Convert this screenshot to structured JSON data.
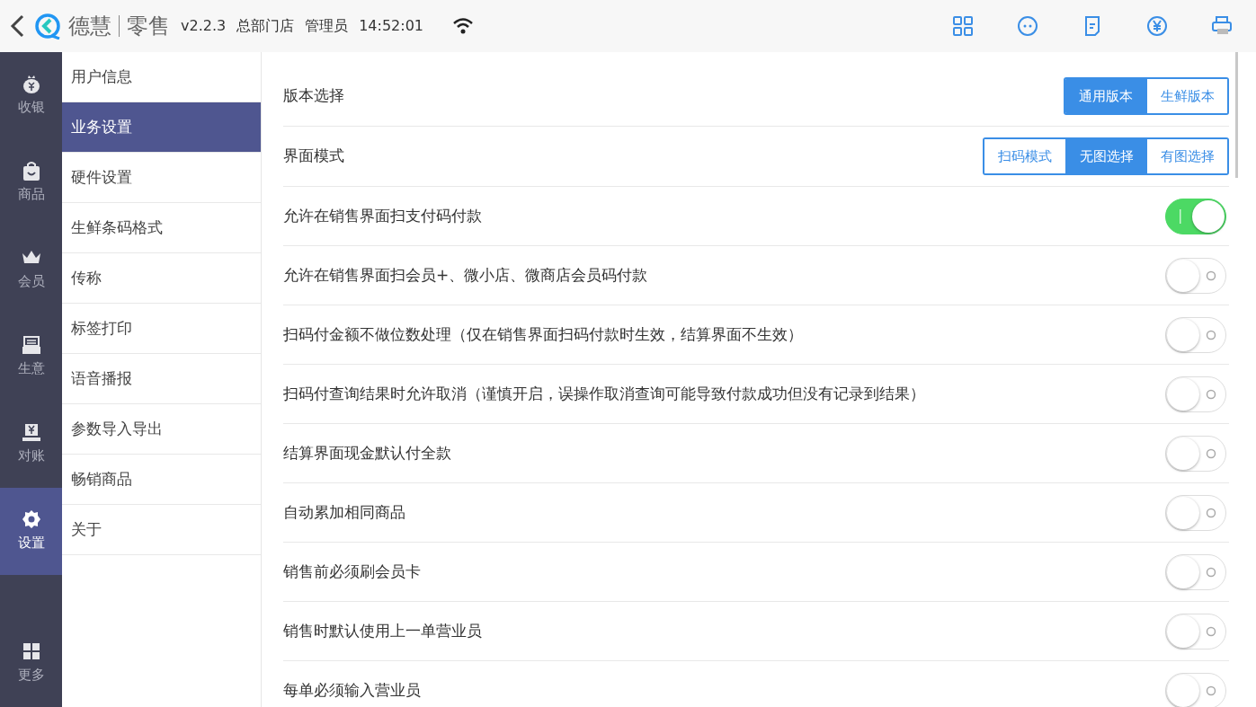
{
  "header": {
    "brand": "德慧",
    "product": "零售",
    "version": "v2.2.3",
    "store": "总部门店",
    "role": "管理员",
    "time": "14:52:01"
  },
  "rail": [
    {
      "label": "收银",
      "selected": false
    },
    {
      "label": "商品",
      "selected": false
    },
    {
      "label": "会员",
      "selected": false
    },
    {
      "label": "生意",
      "selected": false
    },
    {
      "label": "对账",
      "selected": false
    },
    {
      "label": "设置",
      "selected": true
    },
    {
      "label": "更多",
      "selected": false
    }
  ],
  "submenu": [
    {
      "label": "用户信息",
      "selected": false
    },
    {
      "label": "业务设置",
      "selected": true
    },
    {
      "label": "硬件设置",
      "selected": false
    },
    {
      "label": "生鲜条码格式",
      "selected": false
    },
    {
      "label": "传称",
      "selected": false
    },
    {
      "label": "标签打印",
      "selected": false
    },
    {
      "label": "语音播报",
      "selected": false
    },
    {
      "label": "参数导入导出",
      "selected": false
    },
    {
      "label": "畅销商品",
      "selected": false
    },
    {
      "label": "关于",
      "selected": false
    }
  ],
  "settings": [
    {
      "kind": "segmented",
      "label": "版本选择",
      "options": [
        {
          "label": "通用版本",
          "selected": true
        },
        {
          "label": "生鲜版本",
          "selected": false
        }
      ]
    },
    {
      "kind": "segmented",
      "label": "界面模式",
      "options": [
        {
          "label": "扫码模式",
          "selected": false
        },
        {
          "label": "无图选择",
          "selected": true
        },
        {
          "label": "有图选择",
          "selected": false
        }
      ]
    },
    {
      "kind": "toggle",
      "label": "允许在销售界面扫支付码付款",
      "on": true
    },
    {
      "kind": "toggle",
      "label": "允许在销售界面扫会员+、微小店、微商店会员码付款",
      "on": false
    },
    {
      "kind": "toggle",
      "label": "扫码付金额不做位数处理（仅在销售界面扫码付款时生效，结算界面不生效）",
      "on": false
    },
    {
      "kind": "toggle",
      "label": "扫码付查询结果时允许取消（谨慎开启，误操作取消查询可能导致付款成功但没有记录到结果）",
      "on": false
    },
    {
      "kind": "toggle",
      "label": "结算界面现金默认付全款",
      "on": false
    },
    {
      "kind": "toggle",
      "label": "自动累加相同商品",
      "on": false
    },
    {
      "kind": "toggle",
      "label": "销售前必须刷会员卡",
      "on": false
    },
    {
      "kind": "toggle",
      "label": "销售时默认使用上一单营业员",
      "on": false
    },
    {
      "kind": "toggle",
      "label": "每单必须输入营业员",
      "on": false
    }
  ]
}
